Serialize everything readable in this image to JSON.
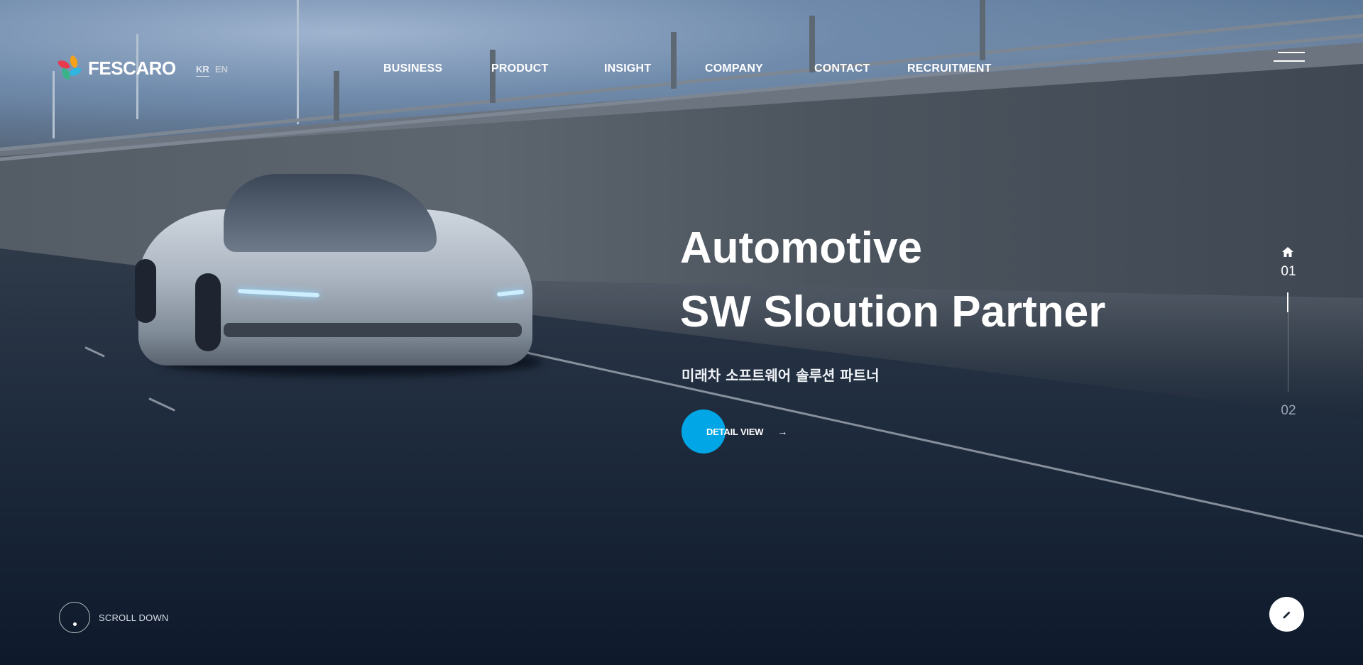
{
  "brand": {
    "logo_text": "FESCARO"
  },
  "languages": [
    {
      "label": "KR",
      "active": true
    },
    {
      "label": "EN",
      "active": false
    }
  ],
  "nav": {
    "items": [
      {
        "label": "BUSINESS"
      },
      {
        "label": "PRODUCT"
      },
      {
        "label": "INSIGHT"
      },
      {
        "label": "COMPANY"
      },
      {
        "label": "CONTACT"
      },
      {
        "label": "RECRUITMENT"
      }
    ],
    "menu_icon": "hamburger-icon"
  },
  "hero": {
    "headline_line1": "Automotive",
    "headline_line2": "SW Sloution Partner",
    "subheadline": "미래차 소프트웨어 솔루션 파트너",
    "cta_label": "DETAIL VIEW",
    "cta_icon": "arrow-right-icon",
    "accent_color": "#00a6e6"
  },
  "pager": {
    "home_icon": "home-icon",
    "current": "01",
    "next": "02"
  },
  "scroll": {
    "label": "SCROLL DOWN"
  },
  "fab": {
    "icon": "pencil-icon"
  }
}
